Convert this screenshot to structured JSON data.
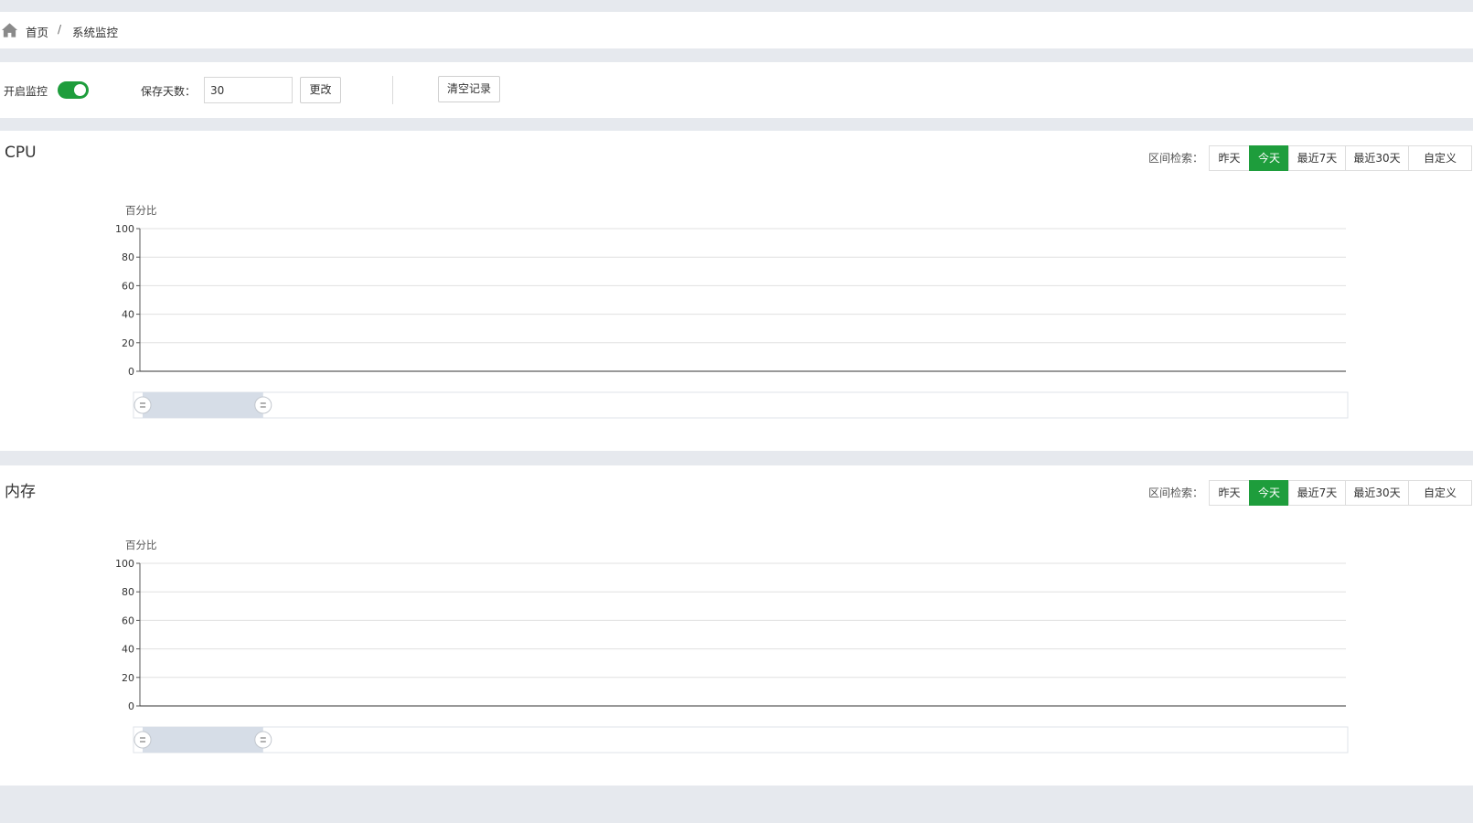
{
  "breadcrumb": {
    "home": "首页",
    "separator": "/",
    "current": "系统监控"
  },
  "toolbar": {
    "monitor_label": "开启监控",
    "monitor_enabled": true,
    "keep_days_label": "保存天数：",
    "keep_days_value": "30",
    "change_button": "更改",
    "clear_button": "清空记录"
  },
  "colors": {
    "accent": "#1e9d3c",
    "page_background": "#e6e9ee"
  },
  "panels": [
    {
      "title": "CPU",
      "range_label": "区间检索：",
      "range_buttons": [
        "昨天",
        "今天",
        "最近7天",
        "最近30天",
        "自定义"
      ],
      "active_range": "今天"
    },
    {
      "title": "内存",
      "range_label": "区间检索：",
      "range_buttons": [
        "昨天",
        "今天",
        "最近7天",
        "最近30天",
        "自定义"
      ],
      "active_range": "今天"
    }
  ],
  "chart_data": [
    {
      "type": "line",
      "ylabel": "百分比",
      "ylim": [
        0,
        100
      ],
      "yticks": [
        0,
        20,
        40,
        60,
        80,
        100
      ],
      "series": [],
      "grid": true,
      "datazoom": {
        "start": 0,
        "end": 0.1
      }
    },
    {
      "type": "line",
      "ylabel": "百分比",
      "ylim": [
        0,
        100
      ],
      "yticks": [
        0,
        20,
        40,
        60,
        80,
        100
      ],
      "series": [],
      "grid": true,
      "datazoom": {
        "start": 0,
        "end": 0.1
      }
    }
  ]
}
